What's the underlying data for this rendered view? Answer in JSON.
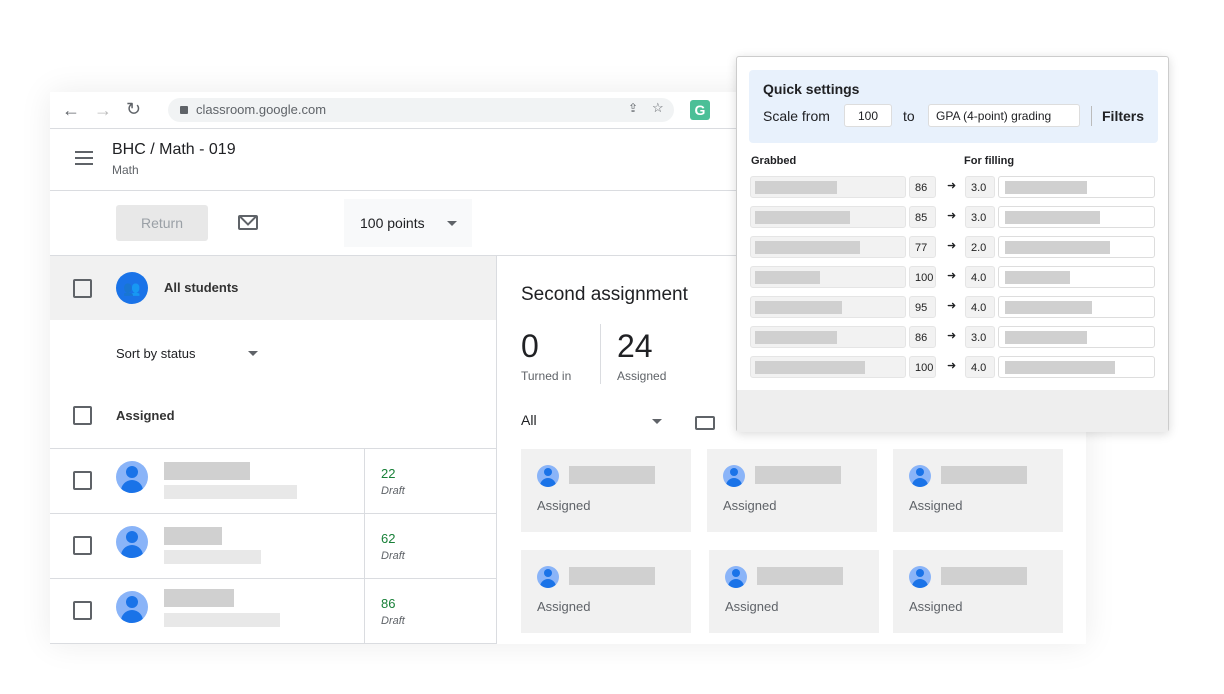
{
  "browser": {
    "url": "classroom.google.com",
    "extension_letter": "G"
  },
  "header": {
    "title": "BHC / Math - 019",
    "subtitle": "Math"
  },
  "toolbar": {
    "return_label": "Return",
    "points_label": "100 points"
  },
  "left": {
    "all_students": "All students",
    "sort_label": "Sort by status",
    "section": "Assigned",
    "students": [
      {
        "grade": "22",
        "status": "Draft"
      },
      {
        "grade": "62",
        "status": "Draft"
      },
      {
        "grade": "86",
        "status": "Draft"
      }
    ]
  },
  "assignment": {
    "title": "Second assignment",
    "turned_in_count": "0",
    "turned_in_label": "Turned in",
    "assigned_count": "24",
    "assigned_label": "Assigned",
    "filter": "All",
    "cards": [
      "Assigned",
      "Assigned",
      "Assigned",
      "Assigned",
      "Assigned",
      "Assigned"
    ]
  },
  "popup": {
    "title": "Quick settings",
    "scale_from_label": "Scale from",
    "scale_from": "100",
    "to_label": "to",
    "scale_to": "GPA (4-point) grading",
    "filters_label": "Filters",
    "grabbed_header": "Grabbed",
    "filling_header": "For filling",
    "rows": [
      {
        "score": "86",
        "gpa": "3.0"
      },
      {
        "score": "85",
        "gpa": "3.0"
      },
      {
        "score": "77",
        "gpa": "2.0"
      },
      {
        "score": "100",
        "gpa": "4.0"
      },
      {
        "score": "95",
        "gpa": "4.0"
      },
      {
        "score": "86",
        "gpa": "3.0"
      },
      {
        "score": "100",
        "gpa": "4.0"
      }
    ]
  },
  "colors": {
    "accent": "#1a73e8",
    "grade_green": "#188038",
    "popup_header_bg": "#e8f1fc"
  }
}
